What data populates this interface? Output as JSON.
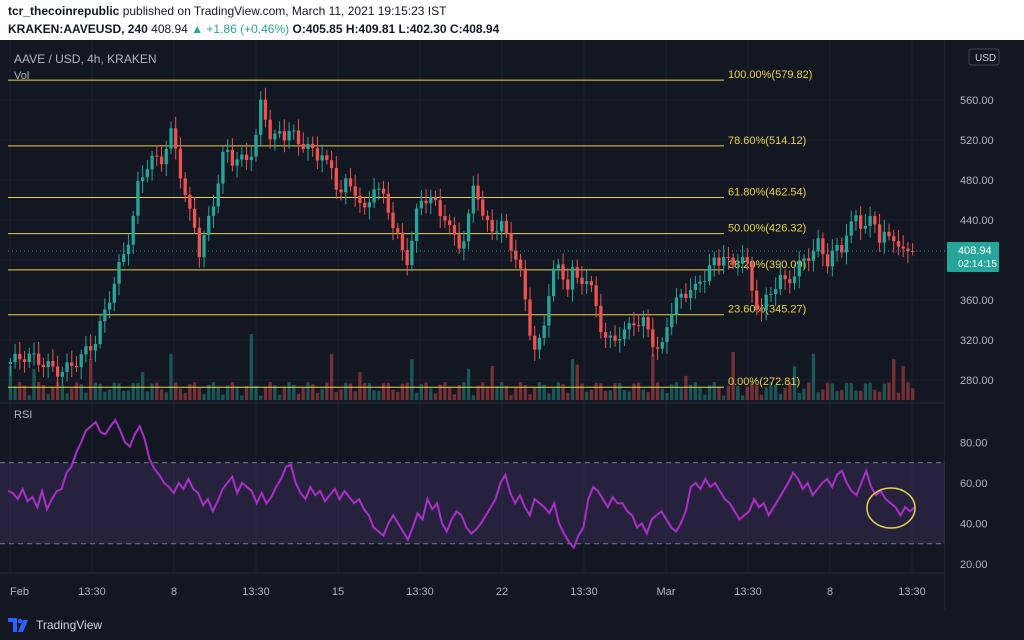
{
  "header": {
    "publisher": "tcr_thecoinrepublic",
    "published_text": "published on TradingView.com, March 11, 2021 19:15:23 IST",
    "symbol_line_prefix": "KRAKEN:AAVEUSD, 240",
    "last": "408.94",
    "change": "▲ +1.86 (+0.46%)",
    "ohlc": "O:405.85 H:409.81 L:402.30 C:408.94"
  },
  "chart_data": {
    "type": "candlestick",
    "title": "AAVE / USD, 4h, KRAKEN",
    "volume_label": "Vol",
    "currency_button": "USD",
    "last_price": 408.94,
    "countdown": "02:14:15",
    "price_axis_ticks": [
      280,
      320,
      360,
      400,
      440,
      480,
      520,
      560
    ],
    "price_axis_labels": [
      "280.00",
      "320.00",
      "360.00",
      "400.00",
      "440.00",
      "480.00",
      "520.00",
      "560.00"
    ],
    "ylim": [
      260,
      600
    ],
    "x_ticks": [
      "Feb",
      "13:30",
      "8",
      "13:30",
      "15",
      "13:30",
      "22",
      "13:30",
      "Mar",
      "13:30",
      "8",
      "13:30"
    ],
    "fibonacci": [
      {
        "label": "100.00%(579.82)",
        "value": 579.82
      },
      {
        "label": "78.60%(514.12)",
        "value": 514.12
      },
      {
        "label": "61.80%(462.54)",
        "value": 462.54
      },
      {
        "label": "50.00%(426.32)",
        "value": 426.32
      },
      {
        "label": "38.20%(390.09)",
        "value": 390.09
      },
      {
        "label": "23.60%(345.27)",
        "value": 345.27
      },
      {
        "label": "0.00%(272.81)",
        "value": 272.81
      }
    ],
    "price_path": [
      [
        0,
        298
      ],
      [
        3,
        300
      ],
      [
        6,
        296
      ],
      [
        9,
        292
      ],
      [
        12,
        300
      ],
      [
        15,
        312
      ],
      [
        17,
        345
      ],
      [
        19,
        385
      ],
      [
        21,
        420
      ],
      [
        22,
        445
      ],
      [
        23,
        480
      ],
      [
        25,
        500
      ],
      [
        27,
        495
      ],
      [
        28,
        510
      ],
      [
        29,
        525
      ],
      [
        30,
        500
      ],
      [
        31,
        475
      ],
      [
        32,
        450
      ],
      [
        33,
        440
      ],
      [
        34,
        410
      ],
      [
        35,
        430
      ],
      [
        36,
        450
      ],
      [
        37,
        470
      ],
      [
        38,
        500
      ],
      [
        39,
        505
      ],
      [
        40,
        495
      ],
      [
        41,
        498
      ],
      [
        42,
        495
      ],
      [
        43,
        505
      ],
      [
        44,
        520
      ],
      [
        45,
        560
      ],
      [
        46,
        545
      ],
      [
        47,
        520
      ],
      [
        48,
        530
      ],
      [
        49,
        525
      ],
      [
        50,
        530
      ],
      [
        51,
        520
      ],
      [
        52,
        510
      ],
      [
        53,
        515
      ],
      [
        54,
        505
      ],
      [
        55,
        500
      ],
      [
        56,
        510
      ],
      [
        57,
        495
      ],
      [
        58,
        490
      ],
      [
        59,
        470
      ],
      [
        60,
        480
      ],
      [
        61,
        475
      ],
      [
        62,
        470
      ],
      [
        63,
        450
      ],
      [
        64,
        440
      ],
      [
        65,
        475
      ],
      [
        66,
        465
      ],
      [
        67,
        460
      ],
      [
        68,
        450
      ],
      [
        69,
        430
      ],
      [
        70,
        420
      ],
      [
        71,
        400
      ],
      [
        72,
        420
      ],
      [
        73,
        450
      ],
      [
        74,
        465
      ],
      [
        75,
        460
      ],
      [
        76,
        455
      ],
      [
        77,
        445
      ],
      [
        78,
        440
      ],
      [
        79,
        425
      ],
      [
        80,
        420
      ],
      [
        81,
        415
      ],
      [
        82,
        430
      ],
      [
        83,
        480
      ],
      [
        84,
        470
      ],
      [
        85,
        440
      ],
      [
        86,
        435
      ],
      [
        87,
        430
      ],
      [
        88,
        435
      ],
      [
        89,
        420
      ],
      [
        90,
        410
      ],
      [
        91,
        395
      ],
      [
        92,
        375
      ],
      [
        93,
        340
      ],
      [
        94,
        310
      ],
      [
        95,
        320
      ],
      [
        96,
        345
      ],
      [
        97,
        385
      ],
      [
        98,
        395
      ],
      [
        99,
        390
      ],
      [
        100,
        370
      ],
      [
        101,
        385
      ],
      [
        102,
        375
      ],
      [
        103,
        380
      ],
      [
        104,
        370
      ],
      [
        105,
        360
      ],
      [
        106,
        335
      ],
      [
        107,
        320
      ],
      [
        108,
        325
      ],
      [
        109,
        330
      ],
      [
        110,
        325
      ],
      [
        111,
        335
      ],
      [
        112,
        340
      ],
      [
        113,
        330
      ],
      [
        114,
        335
      ],
      [
        115,
        320
      ],
      [
        116,
        305
      ],
      [
        117,
        310
      ],
      [
        118,
        340
      ],
      [
        119,
        355
      ],
      [
        120,
        365
      ],
      [
        121,
        370
      ],
      [
        122,
        375
      ],
      [
        123,
        372
      ],
      [
        124,
        380
      ],
      [
        125,
        385
      ],
      [
        126,
        395
      ],
      [
        127,
        390
      ],
      [
        128,
        405
      ],
      [
        129,
        395
      ],
      [
        130,
        390
      ],
      [
        131,
        410
      ],
      [
        132,
        405
      ],
      [
        133,
        375
      ],
      [
        134,
        360
      ],
      [
        135,
        350
      ],
      [
        136,
        365
      ],
      [
        137,
        370
      ],
      [
        138,
        380
      ],
      [
        139,
        372
      ],
      [
        140,
        378
      ],
      [
        141,
        385
      ],
      [
        142,
        395
      ],
      [
        143,
        405
      ],
      [
        144,
        410
      ],
      [
        145,
        420
      ],
      [
        146,
        410
      ],
      [
        147,
        400
      ],
      [
        148,
        415
      ],
      [
        149,
        405
      ],
      [
        150,
        425
      ],
      [
        151,
        430
      ],
      [
        152,
        440
      ],
      [
        153,
        430
      ],
      [
        154,
        435
      ],
      [
        155,
        440
      ],
      [
        156,
        425
      ],
      [
        157,
        430
      ],
      [
        158,
        420
      ],
      [
        159,
        430
      ],
      [
        160,
        410
      ],
      [
        161,
        405
      ],
      [
        162,
        409
      ]
    ],
    "rsi_label": "RSI",
    "rsi_axis_labels": [
      "20.00",
      "40.00",
      "60.00",
      "80.00"
    ],
    "rsi_ticks": [
      20,
      40,
      60,
      80
    ],
    "rsi_band": [
      30,
      70
    ],
    "rsi_ylim": [
      18,
      96
    ],
    "rsi_values": [
      56,
      55,
      52,
      57,
      51,
      53,
      48,
      56,
      47,
      52,
      56,
      57,
      65,
      68,
      75,
      80,
      86,
      88,
      90,
      85,
      84,
      88,
      91,
      86,
      80,
      78,
      84,
      88,
      82,
      72,
      67,
      64,
      60,
      58,
      55,
      60,
      57,
      62,
      57,
      55,
      49,
      52,
      46,
      51,
      57,
      60,
      63,
      55,
      60,
      58,
      56,
      50,
      55,
      50,
      53,
      58,
      62,
      68,
      69,
      60,
      55,
      52,
      58,
      54,
      56,
      51,
      54,
      57,
      52,
      56,
      53,
      50,
      52,
      47,
      44,
      38,
      36,
      34,
      40,
      44,
      40,
      36,
      32,
      38,
      45,
      42,
      52,
      47,
      50,
      40,
      36,
      42,
      46,
      44,
      38,
      35,
      37,
      40,
      44,
      48,
      52,
      60,
      64,
      55,
      50,
      54,
      48,
      44,
      52,
      50,
      48,
      45,
      50,
      40,
      35,
      31,
      28,
      34,
      38,
      52,
      58,
      56,
      52,
      48,
      53,
      50,
      50,
      46,
      44,
      38,
      40,
      35,
      42,
      44,
      46,
      42,
      38,
      36,
      40,
      46,
      58,
      60,
      57,
      62,
      58,
      60,
      56,
      52,
      50,
      46,
      42,
      44,
      46,
      52,
      48,
      50,
      44,
      48,
      52,
      56,
      60,
      65,
      62,
      57,
      60,
      54,
      57,
      60,
      62,
      58,
      64,
      66,
      60,
      56,
      54,
      60,
      66,
      58,
      54,
      56,
      52,
      50,
      48,
      44,
      48,
      46,
      48
    ]
  },
  "footer": {
    "brand": "TradingView"
  }
}
